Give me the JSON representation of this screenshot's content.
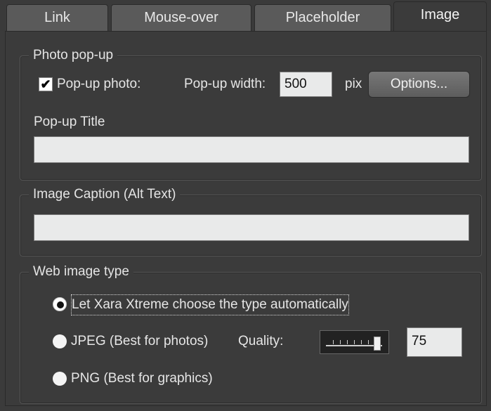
{
  "tabs": [
    {
      "label": "Link"
    },
    {
      "label": "Mouse-over"
    },
    {
      "label": "Placeholder"
    },
    {
      "label": "Image"
    }
  ],
  "photo_popup": {
    "legend": "Photo pop-up",
    "popup_photo_label": "Pop-up photo:",
    "popup_photo_checked": true,
    "popup_width_label": "Pop-up width:",
    "popup_width_value": "500",
    "pix_label": "pix",
    "options_button": "Options...",
    "title_label": "Pop-up Title",
    "title_value": ""
  },
  "caption": {
    "legend": "Image Caption (Alt Text)",
    "value": ""
  },
  "web_image_type": {
    "legend": "Web image type",
    "options": [
      {
        "label": "Let Xara Xtreme choose the type automatically",
        "selected": true
      },
      {
        "label": "JPEG (Best for photos)",
        "selected": false
      },
      {
        "label": "PNG (Best for graphics)",
        "selected": false
      }
    ],
    "quality_label": "Quality:",
    "quality_value": "75"
  }
}
